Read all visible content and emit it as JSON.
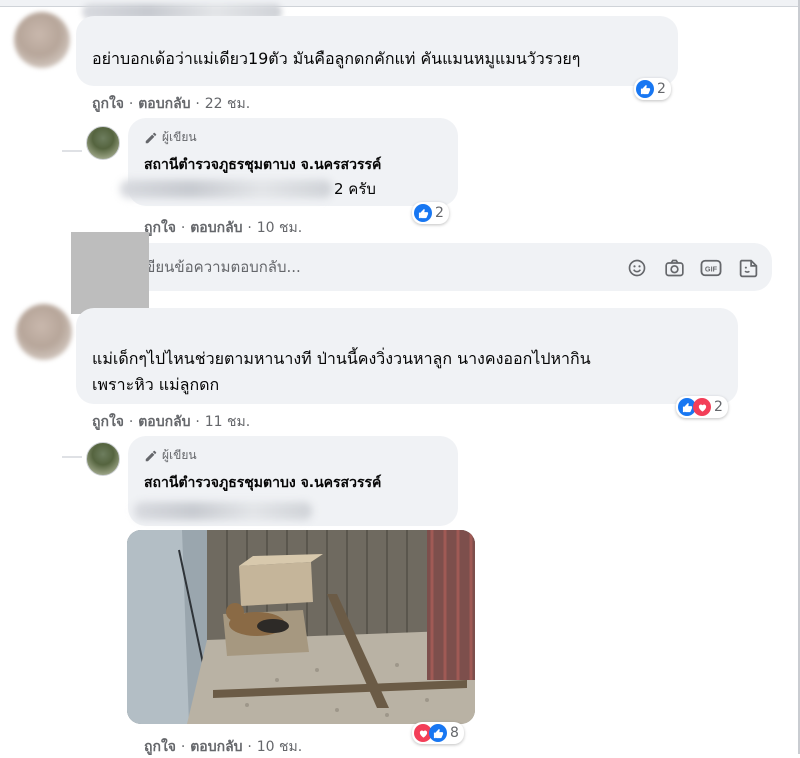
{
  "comments": [
    {
      "text": "อย่าบอกเด้อว่าแม่เดียว19ตัว มันคือลูกดกคักแท่ คันแมนหมูแมนวัวรวยๆ",
      "actions": {
        "like": "ถูกใจ",
        "sep": "·",
        "reply": "ตอบกลับ",
        "time": "22 ชม."
      },
      "reaction_count": "2",
      "reply": {
        "badge": "ผู้เขียน",
        "author": "สถานีตำรวจภูธรชุมตาบง จ.นครสวรรค์",
        "text_visible": "2 ครับ",
        "actions": {
          "like": "ถูกใจ",
          "sep": "·",
          "reply": "ตอบกลับ",
          "time": "10 ชม."
        },
        "reaction_count": "2"
      }
    },
    {
      "text_line1": "แม่เด็กๆไปไหนช่วยตามหานางที ป่านนี้คงวิ่งวนหาลูก นางคงออกไปหากิน",
      "text_line2": "เพราะหิว แม่ลูกดก",
      "actions": {
        "like": "ถูกใจ",
        "sep": "·",
        "reply": "ตอบกลับ",
        "time": "11 ชม."
      },
      "reaction_count": "2",
      "reply": {
        "badge": "ผู้เขียน",
        "author": "สถานีตำรวจภูธรชุมตาบง จ.นครสวรรค์",
        "actions": {
          "like": "ถูกใจ",
          "sep": "·",
          "reply": "ตอบกลับ",
          "time": "10 ชม."
        },
        "reaction_count": "8"
      }
    }
  ],
  "reply_box": {
    "placeholder": "เขียนข้อความตอบกลับ..."
  },
  "icons": {
    "emoji": "emoji-icon",
    "camera": "camera-icon",
    "gif": "gif-icon",
    "sticker": "sticker-icon",
    "gif_label": "GIF"
  },
  "colors": {
    "like_blue": "#1877f2",
    "love_red": "#f33e58",
    "bubble": "#f0f2f5",
    "meta_gray": "#65676b"
  }
}
